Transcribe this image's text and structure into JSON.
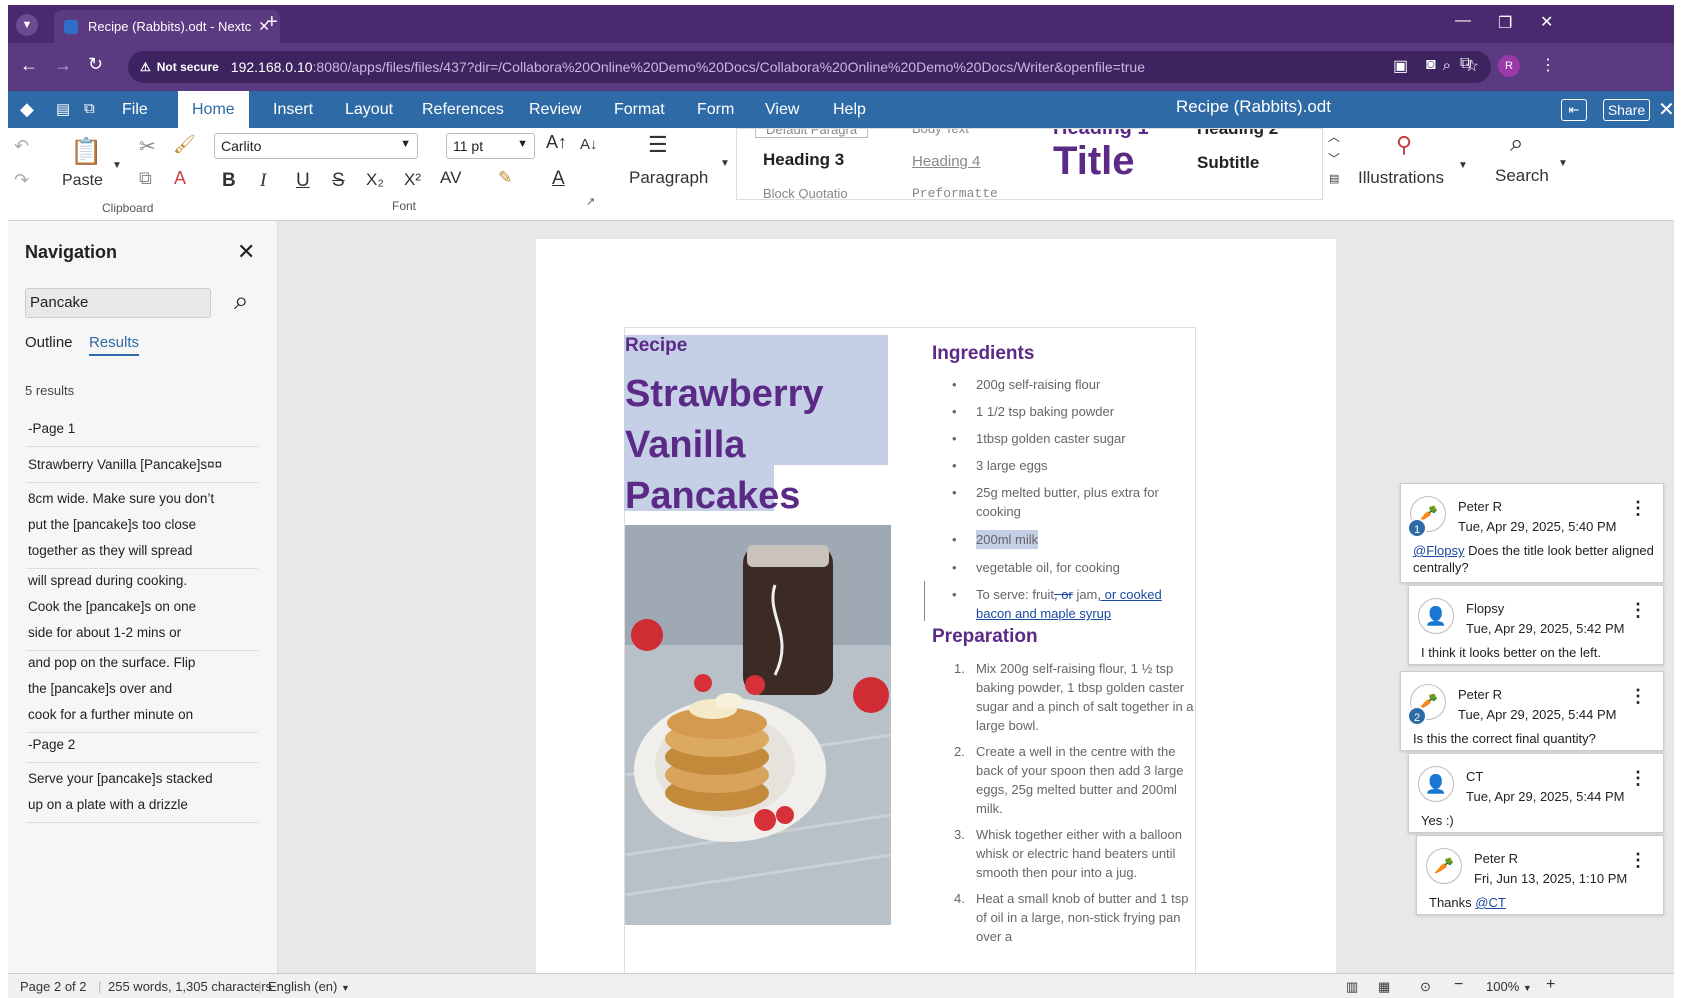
{
  "browser": {
    "tab_title": "Recipe (Rabbits).odt - Nextcloud",
    "not_secure": "Not secure",
    "url_host": "192.168.0.10",
    "url_rest": ":8080/apps/files/files/437?dir=/Collabora%20Online%20Demo%20Docs/Collabora%20Online%20Demo%20Docs/Writer&openfile=true",
    "profile_initial": "R"
  },
  "menu": {
    "items": [
      "File",
      "Home",
      "Insert",
      "Layout",
      "References",
      "Review",
      "Format",
      "Form",
      "View",
      "Help"
    ],
    "active": "Home",
    "doc_title": "Recipe (Rabbits).odt",
    "share": "Share"
  },
  "ribbon": {
    "paste": "Paste",
    "clipboard_label": "Clipboard",
    "font_name": "Carlito",
    "font_size": "11 pt",
    "font_label": "Font",
    "paragraph": "Paragraph",
    "styles": [
      "Default Paragra",
      "Body Text",
      "Heading 1",
      "Heading 2",
      "Heading 3",
      "Heading 4",
      "Title",
      "Subtitle",
      "Block Quotatio",
      "Preformatte"
    ],
    "illustrations": "Illustrations",
    "search": "Search"
  },
  "navigation": {
    "title": "Navigation",
    "search_value": "Pancake",
    "tabs": [
      "Outline",
      "Results"
    ],
    "active_tab": "Results",
    "count": "5 results",
    "results": [
      {
        "lines": [
          "-Page 1"
        ]
      },
      {
        "lines": [
          "Strawberry Vanilla [Pancake]s¤¤"
        ]
      },
      {
        "lines": [
          "8cm wide. Make sure you don’t",
          "put the [pancake]s too close",
          "together as they will spread"
        ]
      },
      {
        "lines": [
          "will spread during cooking.",
          "Cook the [pancake]s on one",
          "side for about 1-2 mins or"
        ]
      },
      {
        "lines": [
          "and pop on the surface. Flip",
          "the [pancake]s over and",
          "cook for a further minute on"
        ]
      },
      {
        "lines": [
          "-Page 2"
        ]
      },
      {
        "lines": [
          "Serve your [pancake]s stacked",
          "up on a plate with a drizzle"
        ]
      }
    ]
  },
  "document": {
    "kicker": "Recipe",
    "title_lines": [
      "Strawberry",
      "Vanilla",
      "Pancakes"
    ],
    "ingredients_heading": "Ingredients",
    "ingredients": [
      "200g self-raising flour",
      "1 1/2 tsp baking powder",
      "1tbsp golden caster sugar",
      "3 large eggs",
      "25g melted butter, plus extra for cooking",
      "200ml milk",
      "vegetable oil, for cooking"
    ],
    "serve_prefix": "To serve: fruit",
    "serve_deleted": ", or",
    "serve_mid": " jam",
    "serve_inserted": ", or cooked bacon and maple syrup",
    "preparation_heading": "Preparation",
    "steps": [
      "Mix 200g self-raising flour, 1 ½ tsp baking powder, 1 tbsp golden caster sugar and a pinch of salt together in a large bowl.",
      "Create a well in the centre with the back of your spoon then add 3 large eggs, 25g melted butter and 200ml milk.",
      "Whisk together either with a balloon whisk or electric hand beaters until smooth then pour into a jug.",
      "Heat a small knob of butter and 1 tsp of oil in a large, non-stick frying pan over a"
    ]
  },
  "comments": [
    {
      "author": "Peter R",
      "date": "Tue, Apr 29, 2025, 5:40 PM",
      "mention": "@Flopsy",
      "text": " Does the title look better aligned centrally?",
      "number": "1"
    },
    {
      "author": "Flopsy",
      "date": "Tue, Apr 29, 2025, 5:42 PM",
      "text": "I think it looks better on the left."
    },
    {
      "author": "Peter R",
      "date": "Tue, Apr 29, 2025, 5:44 PM",
      "text": "Is this the correct final quantity?",
      "number": "2"
    },
    {
      "author": "CT",
      "date": "Tue, Apr 29, 2025, 5:44 PM",
      "text": "Yes :)"
    },
    {
      "author": "Peter R",
      "date": "Fri, Jun 13, 2025, 1:10 PM",
      "text": "Thanks ",
      "mention": "@CT"
    }
  ],
  "status": {
    "page": "Page 2 of 2",
    "words": "255 words, 1,305 characters",
    "language": "English (en)",
    "zoom": "100%"
  },
  "colors": {
    "tabbar": "#4a2a6e",
    "menubar": "#2e6aa6",
    "heading": "#5b2a86",
    "selection": "#c5cfe6"
  }
}
